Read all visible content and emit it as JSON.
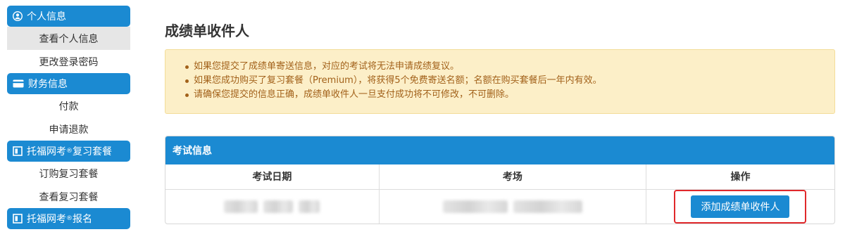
{
  "sidebar": {
    "sections": [
      {
        "label": "个人信息",
        "icon": "user-circle-icon"
      },
      {
        "label": "财务信息",
        "icon": "credit-card-icon"
      },
      {
        "label_main": "托福网考",
        "label_sup": "®",
        "label_rest": "复习套餐",
        "icon": "book-icon"
      },
      {
        "label_main": "托福网考",
        "label_sup": "®",
        "label_rest": "报名",
        "icon": "book-icon"
      }
    ],
    "items": {
      "view_profile": "查看个人信息",
      "change_password": "更改登录密码",
      "payment": "付款",
      "refund": "申请退款",
      "buy_package": "订购复习套餐",
      "view_package": "查看复习套餐"
    }
  },
  "main": {
    "title": "成绩单收件人",
    "notices": [
      "如果您提交了成绩单寄送信息，对应的考试将无法申请成绩复议。",
      "如果您成功购买了复习套餐（Premium），将获得5个免费寄送名额；名额在购买套餐后一年内有效。",
      "请确保您提交的信息正确，成绩单收件人一旦支付成功将不可修改，不可删除。"
    ],
    "panel": {
      "title": "考试信息",
      "columns": [
        "考试日期",
        "考场",
        "操作"
      ],
      "action_button": "添加成绩单收件人"
    }
  },
  "colors": {
    "accent": "#1b8ad2",
    "notice_bg": "#fcefc8",
    "notice_text": "#a2611a",
    "highlight": "#e0282b"
  }
}
